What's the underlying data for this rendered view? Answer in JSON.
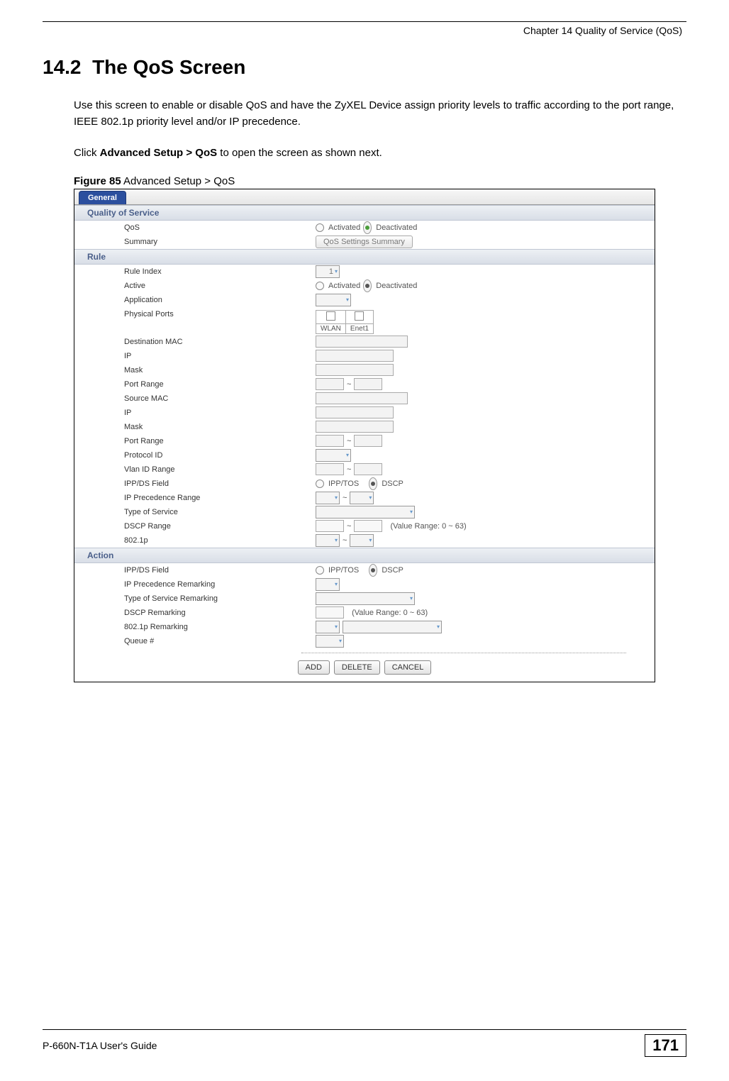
{
  "header": {
    "chapter": "Chapter 14 Quality of Service (QoS)"
  },
  "section": {
    "number": "14.2",
    "title": "The QoS Screen"
  },
  "paragraph1": "Use this screen to enable or disable QoS and have the ZyXEL Device assign priority levels to traffic according to the port range, IEEE 802.1p priority level and/or IP precedence.",
  "paragraph2_prefix": "Click ",
  "paragraph2_bold": "Advanced Setup > QoS",
  "paragraph2_suffix": " to open the screen as shown next.",
  "figure": {
    "label_bold": "Figure 85",
    "label_rest": "   Advanced Setup > QoS"
  },
  "ui": {
    "tab": "General",
    "sections": {
      "qos": "Quality of Service",
      "rule": "Rule",
      "action": "Action"
    },
    "labels": {
      "qos": "QoS",
      "summary": "Summary",
      "rule_index": "Rule Index",
      "active": "Active",
      "application": "Application",
      "physical_ports": "Physical Ports",
      "dest_mac": "Destination MAC",
      "ip": "IP",
      "mask": "Mask",
      "port_range": "Port Range",
      "source_mac": "Source MAC",
      "ip2": "IP",
      "mask2": "Mask",
      "port_range2": "Port Range",
      "protocol_id": "Protocol ID",
      "vlan_id_range": "Vlan ID Range",
      "ipp_ds": "IPP/DS Field",
      "ip_prec_range": "IP Precedence Range",
      "tos": "Type of Service",
      "dscp_range": "DSCP Range",
      "p8021": "802.1p",
      "ipp_ds2": "IPP/DS Field",
      "ip_prec_remark": "IP Precedence Remarking",
      "tos_remark": "Type of Service Remarking",
      "dscp_remark": "DSCP Remarking",
      "p8021_remark": "802.1p Remarking",
      "queue": "Queue #"
    },
    "opts": {
      "activated": "Activated",
      "deactivated": "Deactivated",
      "ipp_tos": "IPP/TOS",
      "dscp": "DSCP",
      "tilde": "~",
      "wlan": "WLAN",
      "enet1": "Enet1",
      "value_range": "(Value Range: 0 ~ 63)",
      "rule_index_val": "1"
    },
    "buttons": {
      "summary": "QoS Settings Summary",
      "add": "ADD",
      "delete": "DELETE",
      "cancel": "CANCEL"
    }
  },
  "footer": {
    "guide": "P-660N-T1A User's Guide",
    "page": "171"
  }
}
